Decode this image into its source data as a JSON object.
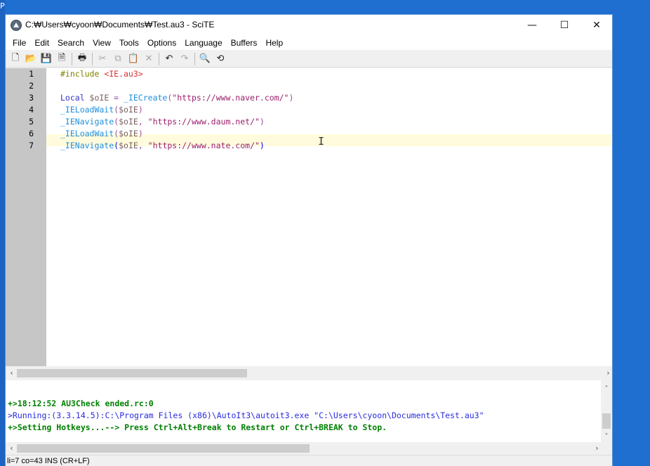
{
  "window": {
    "title": "C:₩Users₩cyoon₩Documents₩Test.au3 - SciTE",
    "minimize_glyph": "—",
    "maximize_glyph": "☐",
    "close_glyph": "✕"
  },
  "menu": [
    "File",
    "Edit",
    "Search",
    "View",
    "Tools",
    "Options",
    "Language",
    "Buffers",
    "Help"
  ],
  "toolbar": {
    "icons": [
      "new-file-icon",
      "open-folder-icon",
      "save-icon",
      "close-file-icon",
      "print-icon",
      "cut-icon",
      "copy-icon",
      "paste-icon",
      "delete-icon",
      "undo-icon",
      "redo-icon",
      "find-icon",
      "replace-icon"
    ],
    "glyphs": {
      "new": "🗋",
      "open": "📂",
      "save": "💾",
      "close": "🗎",
      "print": "🖶",
      "cut": "✂",
      "copy": "⧉",
      "paste": "📋",
      "delete": "✕",
      "undo": "↶",
      "redo": "↷",
      "find": "🔍",
      "replace": "⟲"
    }
  },
  "editor": {
    "line_numbers": [
      "1",
      "2",
      "3",
      "4",
      "5",
      "6",
      "7"
    ],
    "lines": [
      [
        {
          "t": "#include ",
          "c": "pre"
        },
        {
          "t": "<IE.au3>",
          "c": "inc"
        }
      ],
      [],
      [
        {
          "t": "Local ",
          "c": "kw"
        },
        {
          "t": "$oIE",
          "c": "var"
        },
        {
          "t": " = ",
          "c": "op"
        },
        {
          "t": "_IECreate",
          "c": "fn"
        },
        {
          "t": "(",
          "c": "op"
        },
        {
          "t": "\"https://www.naver.com/\"",
          "c": "str"
        },
        {
          "t": ")",
          "c": "op"
        }
      ],
      [
        {
          "t": "_IELoadWait",
          "c": "fn"
        },
        {
          "t": "(",
          "c": "op"
        },
        {
          "t": "$oIE",
          "c": "var"
        },
        {
          "t": ")",
          "c": "op"
        }
      ],
      [
        {
          "t": "_IENavigate",
          "c": "fn"
        },
        {
          "t": "(",
          "c": "op"
        },
        {
          "t": "$oIE",
          "c": "var"
        },
        {
          "t": ", ",
          "c": "op"
        },
        {
          "t": "\"https://www.daum.net/\"",
          "c": "str"
        },
        {
          "t": ")",
          "c": "op"
        }
      ],
      [
        {
          "t": "_IELoadWait",
          "c": "fn"
        },
        {
          "t": "(",
          "c": "op"
        },
        {
          "t": "$oIE",
          "c": "var"
        },
        {
          "t": ")",
          "c": "op"
        }
      ],
      [
        {
          "t": "_IENavigate",
          "c": "fn"
        },
        {
          "t": "(",
          "c": "brace"
        },
        {
          "t": "$oIE",
          "c": "var"
        },
        {
          "t": ", ",
          "c": "op"
        },
        {
          "t": "\"https://www.nate.com/\"",
          "c": "str"
        },
        {
          "t": ")",
          "c": "brace"
        }
      ]
    ],
    "ibeam_glyph": "I"
  },
  "output": {
    "lines": [
      {
        "text": "+>18:12:52 AU3Check ended.rc:0",
        "style": "green"
      },
      {
        "text": ">Running:(3.3.14.5):C:\\Program Files (x86)\\AutoIt3\\autoit3.exe \"C:\\Users\\cyoon\\Documents\\Test.au3\"",
        "style": "blue"
      },
      {
        "text": "+>Setting Hotkeys...--> Press Ctrl+Alt+Break to Restart or Ctrl+BREAK to Stop.",
        "style": "green"
      }
    ]
  },
  "scroll_glyphs": {
    "left": "‹",
    "right": "›",
    "up": "˄",
    "down": "˅"
  },
  "status": "li=7 co=43 INS (CR+LF)",
  "desktop_glyph": "P"
}
